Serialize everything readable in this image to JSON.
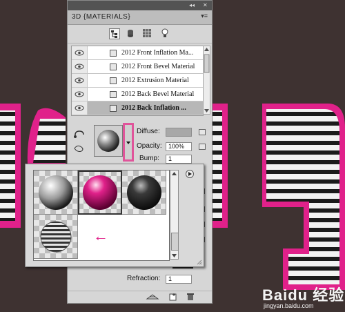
{
  "panel": {
    "title": "3D {MATERIALS}",
    "menu_glyph": "▾≡",
    "collapse_glyph": "◂◂",
    "close_glyph": "✕"
  },
  "materials": {
    "items": [
      {
        "label": "2012 Front Inflation Ma..."
      },
      {
        "label": "2012 Front Bevel Material"
      },
      {
        "label": "2012 Extrusion Material"
      },
      {
        "label": "2012 Back Bevel Material"
      },
      {
        "label": "2012 Back Inflation ..."
      }
    ],
    "selected_index": 4
  },
  "properties": {
    "diffuse_label": "Diffuse:",
    "opacity_label": "Opacity:",
    "opacity_value": "100%",
    "bump_label": "Bump:",
    "bump_value": "1",
    "refraction_label": "Refraction:",
    "refraction_value": "1"
  },
  "popup": {
    "arrow_glyph": "←",
    "menu_glyph": "▶"
  },
  "background": {
    "text": "2012",
    "accent_color": "#e0218a"
  },
  "watermark": {
    "brand": "Baidu 经验",
    "url": "jingyan.baidu.com"
  }
}
